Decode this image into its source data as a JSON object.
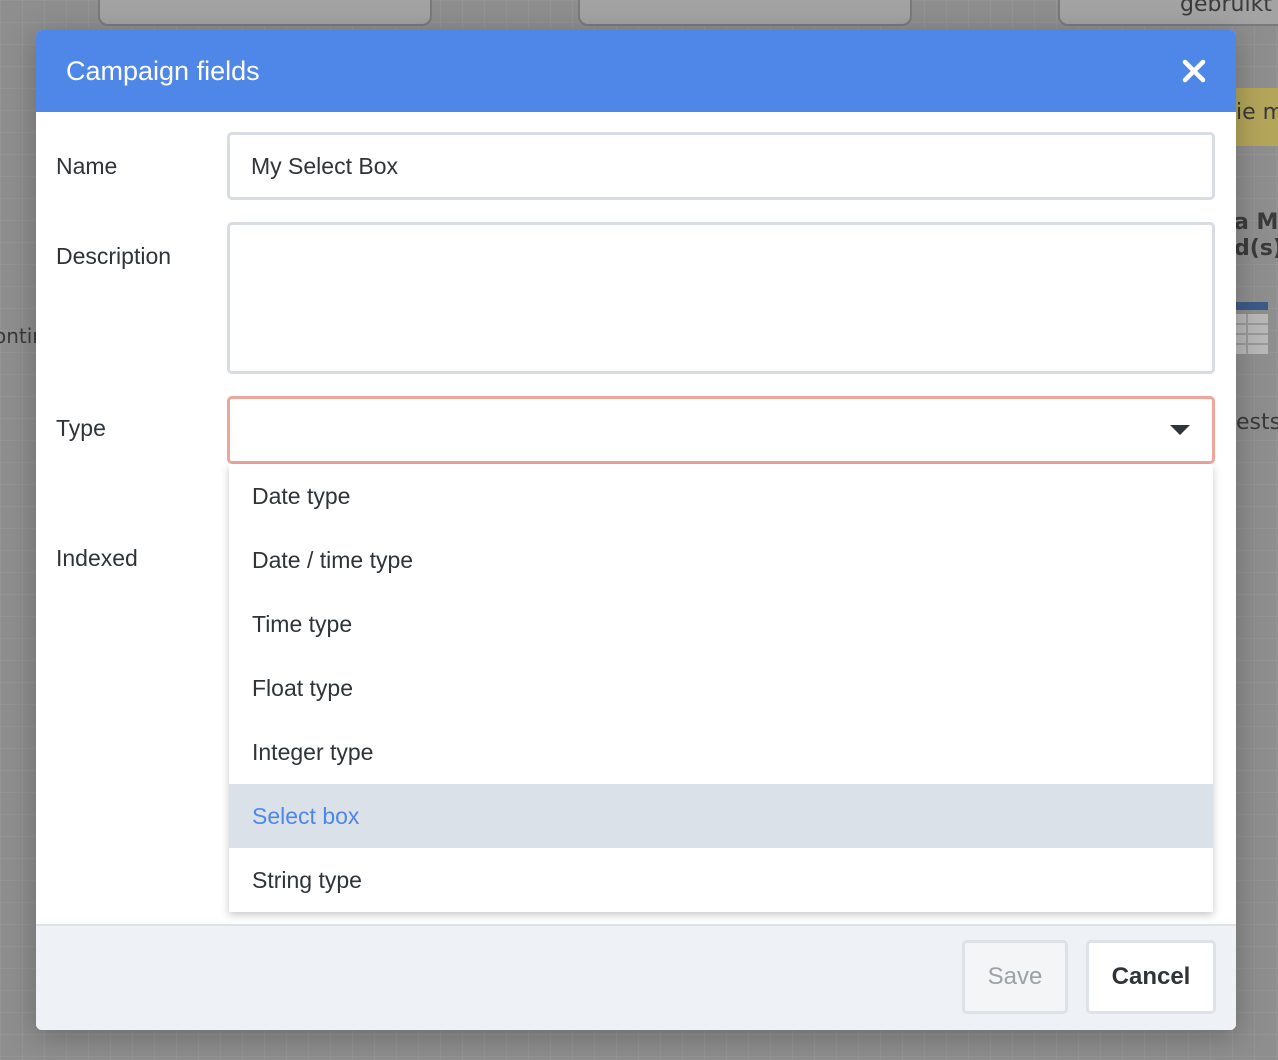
{
  "background": {
    "fragments": [
      "gebruikt",
      "ie m",
      "a Mo",
      "d(s)",
      "ontir",
      "ests"
    ]
  },
  "modal": {
    "title": "Campaign fields",
    "close_icon": "close-icon",
    "header_color": "#4f87e8"
  },
  "form": {
    "name_label": "Name",
    "name_value": "My Select Box",
    "description_label": "Description",
    "description_value": "",
    "type_label": "Type",
    "type_value": "",
    "indexed_label": "Indexed"
  },
  "type_options": [
    {
      "label": "Date type"
    },
    {
      "label": "Date / time type"
    },
    {
      "label": "Time type"
    },
    {
      "label": "Float type"
    },
    {
      "label": "Integer type"
    },
    {
      "label": "Select box",
      "highlighted": true
    },
    {
      "label": "String type"
    }
  ],
  "footer": {
    "save_label": "Save",
    "cancel_label": "Cancel"
  },
  "colors": {
    "accent": "#4f87e8",
    "error_border": "#f0a59b",
    "highlight_bg": "#dbe1e8"
  }
}
